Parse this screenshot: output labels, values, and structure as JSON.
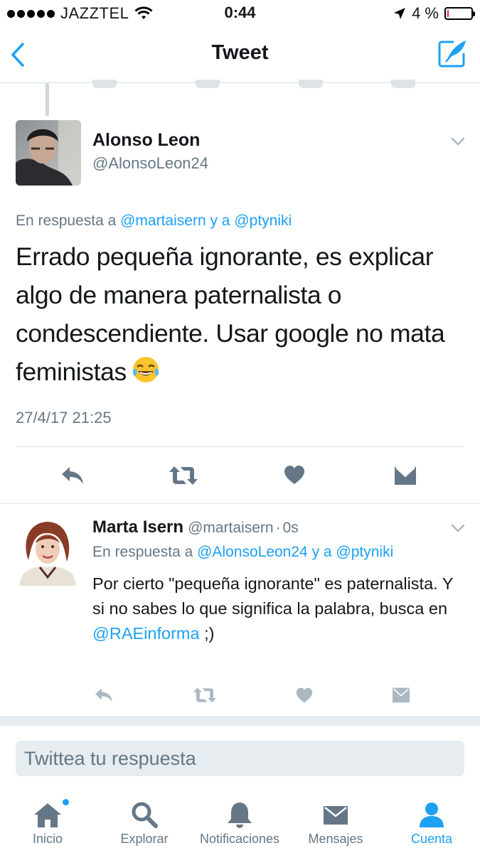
{
  "status_bar": {
    "carrier": "JAZZTEL",
    "time": "0:44",
    "battery_text": "4 %",
    "battery_level": 0.04
  },
  "nav": {
    "title": "Tweet",
    "back_icon": "chevron-left-icon",
    "compose_icon": "compose-tweet-icon"
  },
  "tweet": {
    "author_name": "Alonso Leon",
    "author_handle": "@AlonsoLeon24",
    "reply_prefix": "En respuesta a",
    "reply_user_1": "@martaisern",
    "reply_and": "y a",
    "reply_user_2": "@ptyniki",
    "text": "Errado pequeña ignorante, es explicar algo de manera paternalista o condescendiente. Usar google no mata feministas",
    "emoji": "face-with-tears-of-joy",
    "date": "27/4/17 21:25"
  },
  "reply": {
    "author_name": "Marta Isern",
    "author_handle": "@martaisern",
    "separator": "·",
    "time_ago": "0s",
    "reply_prefix": "En respuesta a",
    "reply_user_1": "@AlonsoLeon24",
    "reply_and": "y a",
    "reply_user_2": "@ptyniki",
    "text_main": "Por cierto \"pequeña ignorante\" es paternalista. Y si no sabes lo que significa la palabra, busca en",
    "text_mention": "@RAEinforma",
    "text_end": " ;)"
  },
  "reply_box": {
    "placeholder": "Twittea tu respuesta"
  },
  "tabs": [
    {
      "label": "Inicio",
      "icon": "home-icon",
      "has_notification_dot": true
    },
    {
      "label": "Explorar",
      "icon": "search-icon"
    },
    {
      "label": "Notificaciones",
      "icon": "bell-icon"
    },
    {
      "label": "Mensajes",
      "icon": "mail-icon"
    },
    {
      "label": "Cuenta",
      "icon": "person-icon",
      "active": true
    }
  ],
  "colors": {
    "accent": "#1da1f2",
    "secondary_text": "#657786",
    "primary_text": "#14171a",
    "action_icon": "#657786",
    "divider": "#e1e8ed",
    "battery_low": "#e0245e"
  }
}
